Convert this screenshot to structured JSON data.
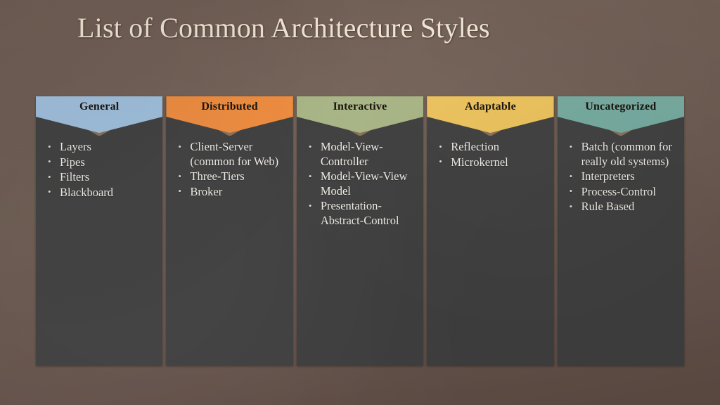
{
  "slide": {
    "title": "List of Common Architecture Styles",
    "background_color": "#6b5a50",
    "panel_color": "#3f3f3f",
    "panel_rim_color": "#8a7058",
    "body_text_color": "#f2efe9",
    "header_text_color": "#17120c",
    "title_color": "#efe4d3"
  },
  "columns": [
    {
      "header": "General",
      "accent_color": "#9fc0dd",
      "items": [
        "Layers",
        "Pipes",
        "Filters",
        "Blackboard"
      ]
    },
    {
      "header": "Distributed",
      "accent_color": "#ef8c3e",
      "items": [
        "Client-Server (common for Web)",
        "Three-Tiers",
        "Broker"
      ]
    },
    {
      "header": "Interactive",
      "accent_color": "#a8b585",
      "items": [
        "Model-View-Controller",
        "Model-View-View Model",
        "Presentation-Abstract-Control"
      ]
    },
    {
      "header": "Adaptable",
      "accent_color": "#edc35c",
      "items": [
        "Reflection",
        "Microkernel"
      ]
    },
    {
      "header": "Uncategorized",
      "accent_color": "#75aa9f",
      "items": [
        "Batch (common for really old systems)",
        "Interpreters",
        "Process-Control",
        "Rule Based"
      ]
    }
  ]
}
